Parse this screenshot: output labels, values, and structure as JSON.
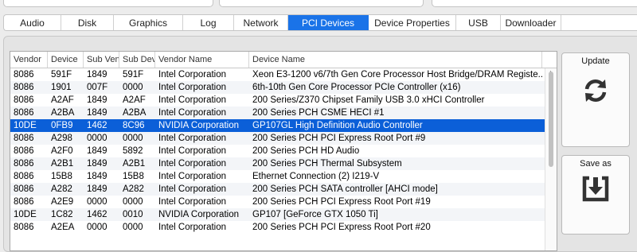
{
  "tabs": [
    {
      "label": "Audio",
      "active": false
    },
    {
      "label": "Disk",
      "active": false
    },
    {
      "label": "Graphics",
      "active": false
    },
    {
      "label": "Log",
      "active": false
    },
    {
      "label": "Network",
      "active": false
    },
    {
      "label": "PCI Devices",
      "active": true
    },
    {
      "label": "Device Properties",
      "active": false
    },
    {
      "label": "USB",
      "active": false
    },
    {
      "label": "Downloader",
      "active": false
    }
  ],
  "table": {
    "columns": [
      "Vendor",
      "Device",
      "Sub Ven",
      "Sub Dev",
      "Vendor Name",
      "Device Name"
    ],
    "rows": [
      [
        "8086",
        "591F",
        "1849",
        "591F",
        "Intel Corporation",
        "Xeon E3-1200 v6/7th Gen Core Processor Host Bridge/DRAM Registe..."
      ],
      [
        "8086",
        "1901",
        "007F",
        "0000",
        "Intel Corporation",
        "6th-10th Gen Core Processor PCIe Controller (x16)"
      ],
      [
        "8086",
        "A2AF",
        "1849",
        "A2AF",
        "Intel Corporation",
        "200 Series/Z370 Chipset Family USB 3.0 xHCI Controller"
      ],
      [
        "8086",
        "A2BA",
        "1849",
        "A2BA",
        "Intel Corporation",
        "200 Series PCH CSME HECI #1"
      ],
      [
        "10DE",
        "0FB9",
        "1462",
        "8C96",
        "NVIDIA Corporation",
        "GP107GL High Definition Audio Controller"
      ],
      [
        "8086",
        "A298",
        "0000",
        "0000",
        "Intel Corporation",
        "200 Series PCH PCI Express Root Port #9"
      ],
      [
        "8086",
        "A2F0",
        "1849",
        "5892",
        "Intel Corporation",
        "200 Series PCH HD Audio"
      ],
      [
        "8086",
        "A2B1",
        "1849",
        "A2B1",
        "Intel Corporation",
        "200 Series PCH Thermal Subsystem"
      ],
      [
        "8086",
        "15B8",
        "1849",
        "15B8",
        "Intel Corporation",
        "Ethernet Connection (2) I219-V"
      ],
      [
        "8086",
        "A282",
        "1849",
        "A282",
        "Intel Corporation",
        "200 Series PCH SATA controller [AHCI mode]"
      ],
      [
        "8086",
        "A2E9",
        "0000",
        "0000",
        "Intel Corporation",
        "200 Series PCH PCI Express Root Port #19"
      ],
      [
        "10DE",
        "1C82",
        "1462",
        "0010",
        "NVIDIA Corporation",
        "GP107 [GeForce GTX 1050 Ti]"
      ],
      [
        "8086",
        "A2EA",
        "0000",
        "0000",
        "Intel Corporation",
        "200 Series PCH PCI Express Root Port #20"
      ]
    ],
    "selected_index": 4
  },
  "buttons": {
    "update": {
      "label": "Update",
      "icon": "refresh-icon"
    },
    "save": {
      "label": "Save as",
      "icon": "save-download-icon"
    }
  },
  "colors": {
    "accent": "#1a73e8",
    "selection": "#0b5fd8"
  }
}
